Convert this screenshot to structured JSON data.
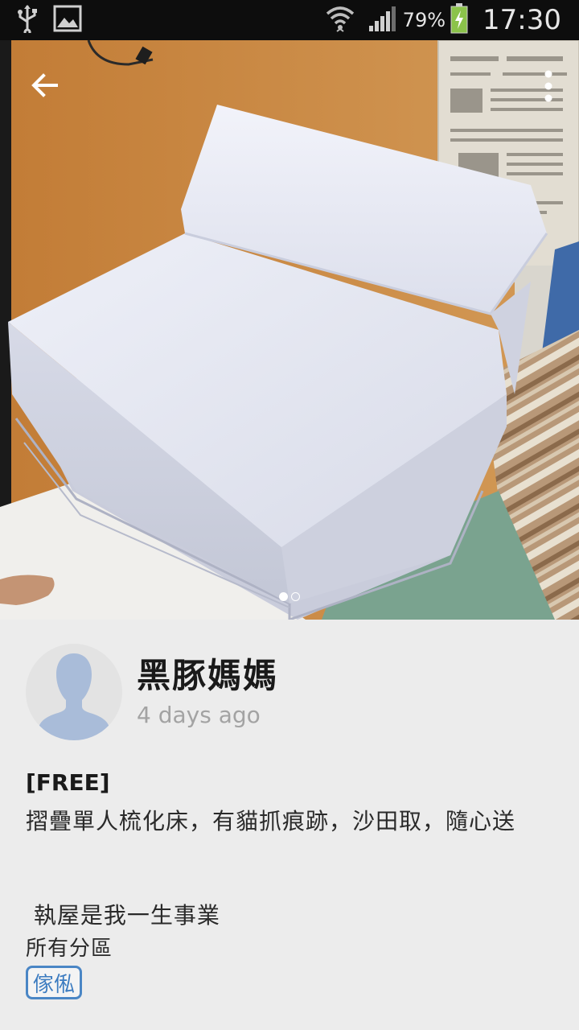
{
  "status_bar": {
    "battery_percent": "79%",
    "time": "17:30",
    "icons": [
      "usb-icon",
      "image-icon",
      "wifi-icon",
      "signal-icon",
      "battery-charging-icon"
    ]
  },
  "listing": {
    "image_count": 2,
    "active_image_index": 0,
    "seller_name": "黑豚媽媽",
    "posted": "4 days ago",
    "title": "[FREE]",
    "description": "摺疊單人梳化床，有貓抓痕跡，沙田取，隨心送",
    "slogan": " 執屋是我一生事業",
    "district": "所有分區",
    "category_tag": "傢俬"
  },
  "colors": {
    "status_bar_bg": "#0d0d0d",
    "page_bg": "#ececec",
    "tag_accent": "#4a86c5",
    "battery_green": "#8bc34a"
  }
}
